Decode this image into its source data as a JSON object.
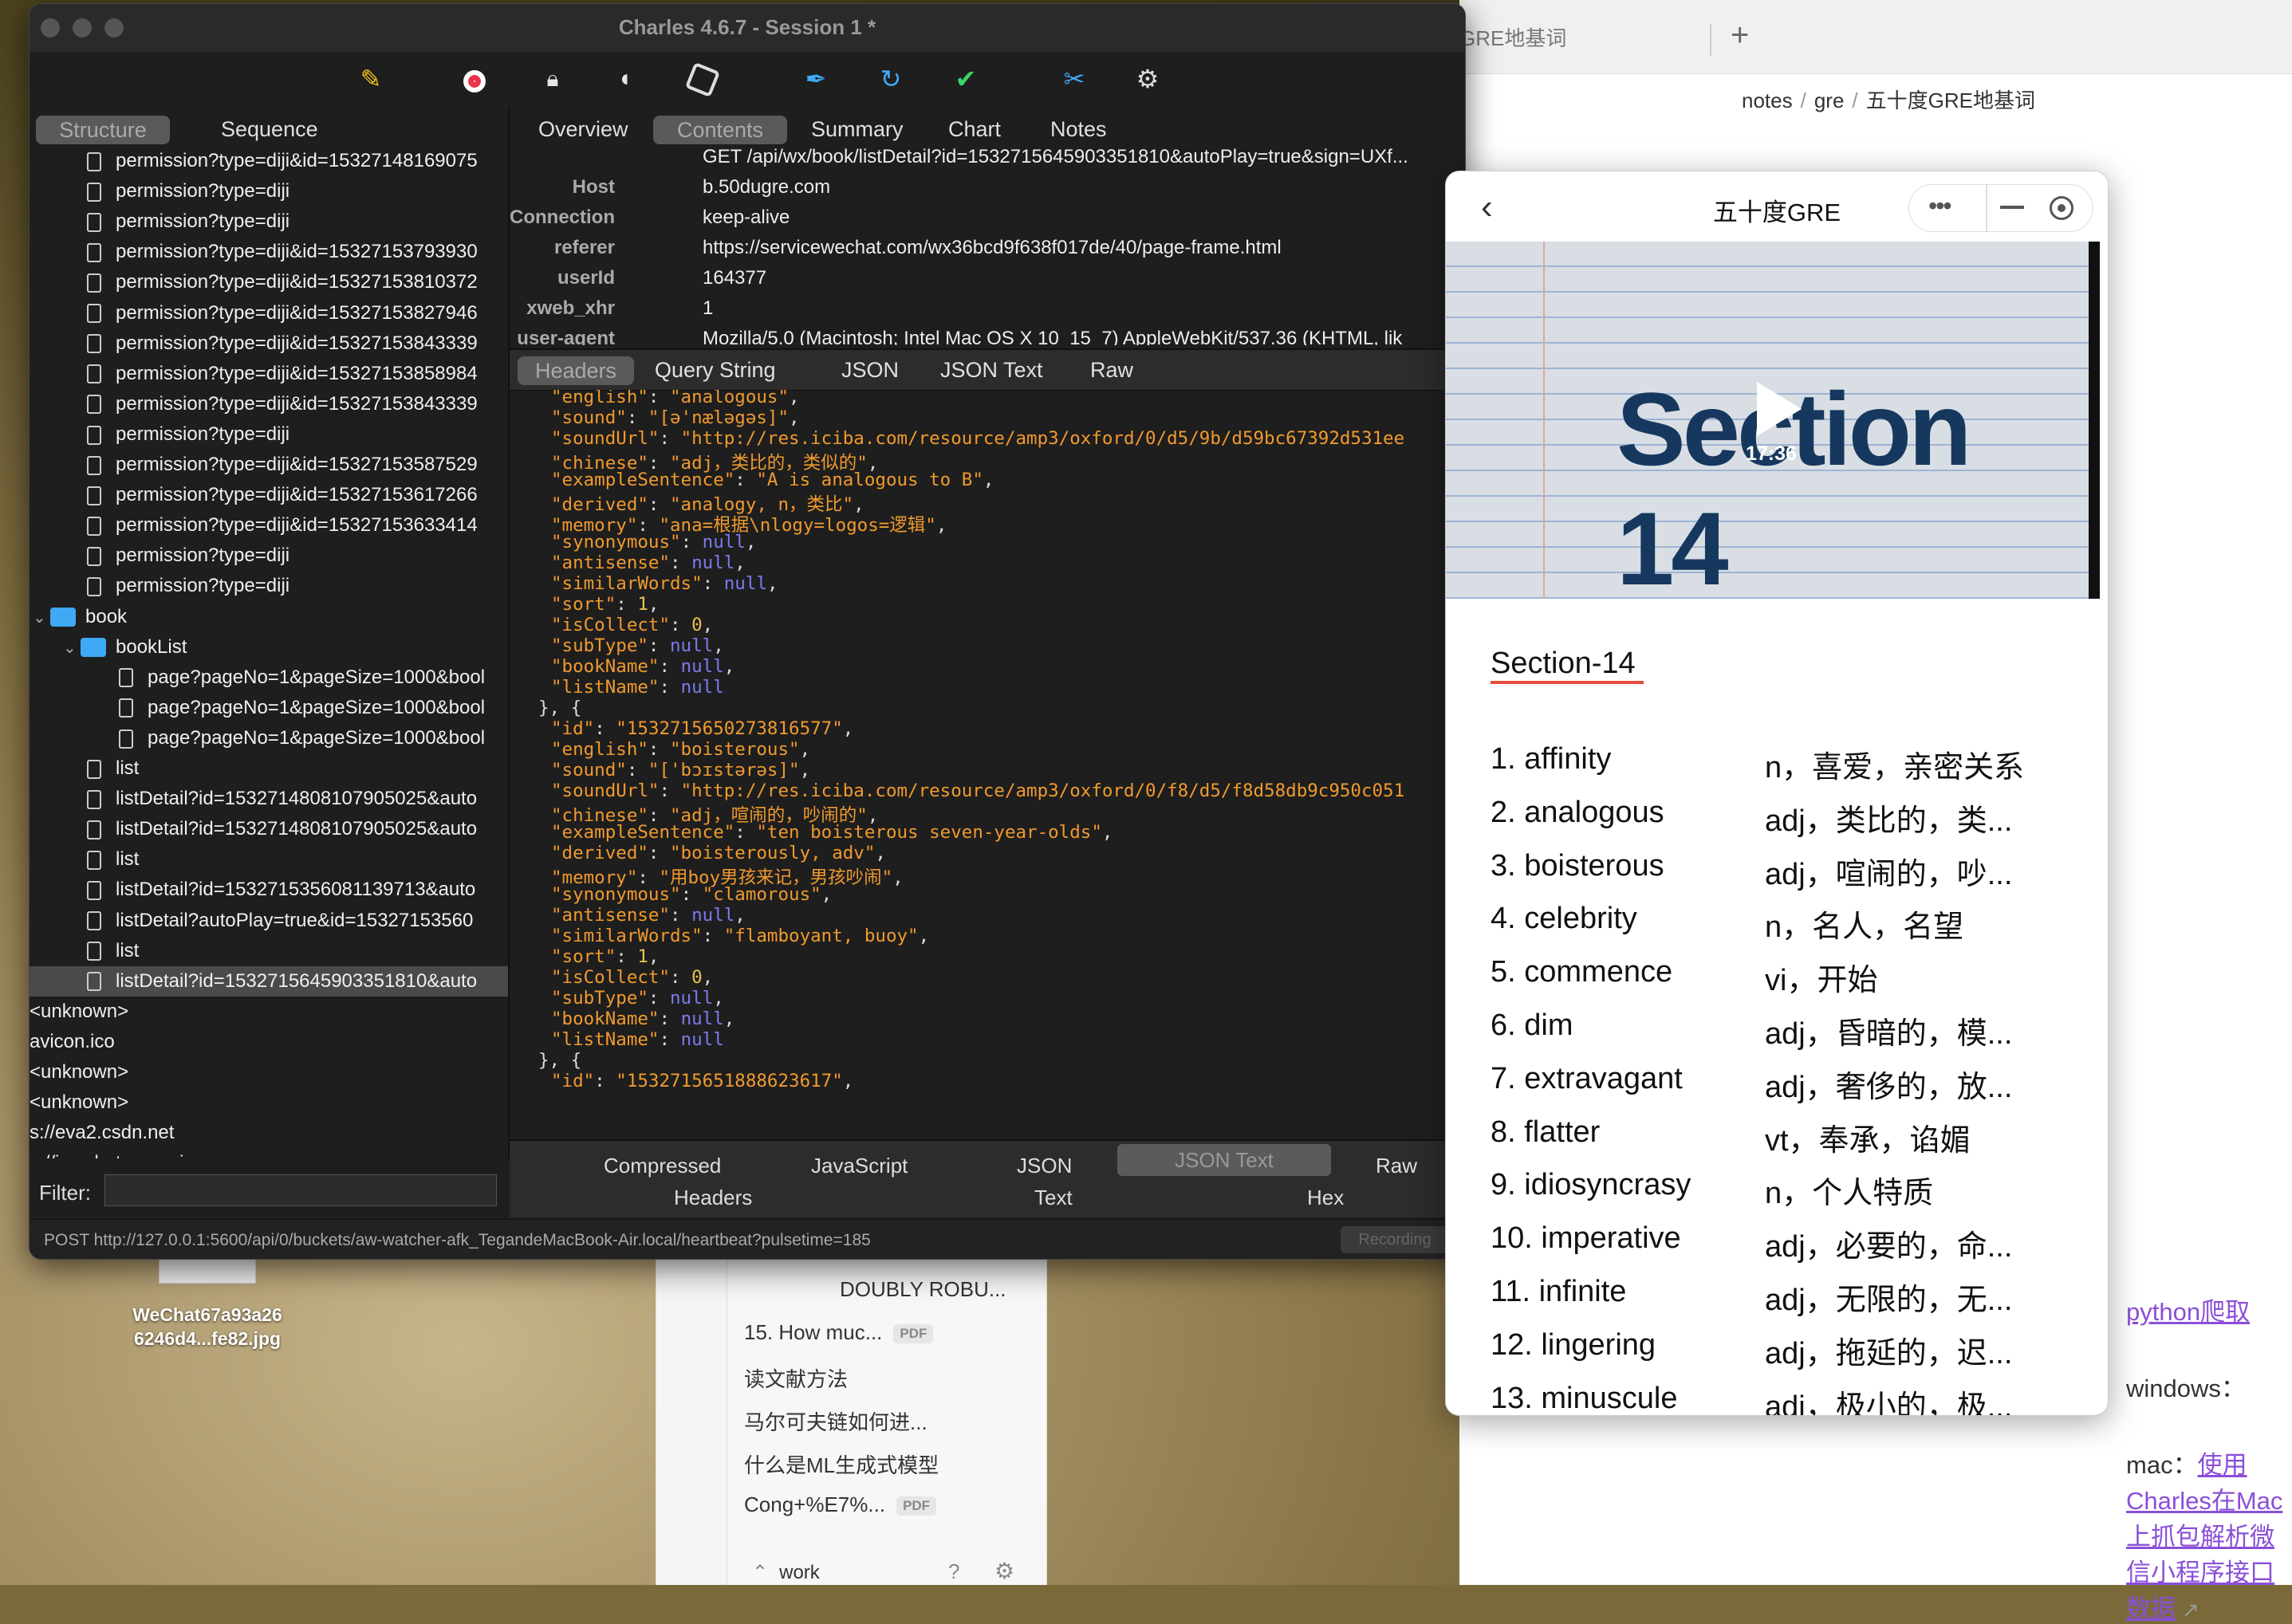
{
  "desktop": {
    "file_name_line1": "WeChat67a93a26",
    "file_name_line2": "6246d4...fe82.jpg"
  },
  "browser": {
    "tab_label": "GRE地基词",
    "new_tab_symbol": "+",
    "breadcrumb": [
      "notes",
      "gre",
      "五十度GRE地基词"
    ],
    "python_link": "python爬取",
    "windows_label": "windows：",
    "mac_label": "mac：",
    "mac_link": "使用Charles在Mac上抓包解析微信小程序接口数据"
  },
  "notes_sidebar": {
    "items": [
      {
        "label": "DOUBLY ROBU...",
        "badge": ""
      },
      {
        "label": "15. How muc...",
        "badge": "PDF"
      },
      {
        "label": "读文献方法",
        "badge": ""
      },
      {
        "label": "马尔可夫链如何进...",
        "badge": ""
      },
      {
        "label": "什么是ML生成式模型",
        "badge": ""
      },
      {
        "label": "Cong+%E7%...",
        "badge": "PDF"
      }
    ],
    "workspace": "work"
  },
  "charles": {
    "title": "Charles 4.6.7 - Session 1 *",
    "toolbar_icons": [
      "broom-icon",
      "record-icon",
      "lock-icon",
      "turtle-icon",
      "stop-icon",
      "pen-icon",
      "refresh-icon",
      "check-icon",
      "tools-icon",
      "settings-icon"
    ],
    "left_tabs": {
      "structure": "Structure",
      "sequence": "Sequence"
    },
    "right_tabs": {
      "overview": "Overview",
      "contents": "Contents",
      "summary": "Summary",
      "chart": "Chart",
      "notes": "Notes"
    },
    "tree": [
      {
        "indent": 2,
        "type": "file",
        "label": "permission?type=diji&id=15327148169075"
      },
      {
        "indent": 2,
        "type": "file",
        "label": "permission?type=diji"
      },
      {
        "indent": 2,
        "type": "file",
        "label": "permission?type=diji"
      },
      {
        "indent": 2,
        "type": "file",
        "label": "permission?type=diji&id=15327153793930"
      },
      {
        "indent": 2,
        "type": "file",
        "label": "permission?type=diji&id=15327153810372"
      },
      {
        "indent": 2,
        "type": "file",
        "label": "permission?type=diji&id=15327153827946"
      },
      {
        "indent": 2,
        "type": "file",
        "label": "permission?type=diji&id=15327153843339"
      },
      {
        "indent": 2,
        "type": "file",
        "label": "permission?type=diji&id=15327153858984"
      },
      {
        "indent": 2,
        "type": "file",
        "label": "permission?type=diji&id=15327153843339"
      },
      {
        "indent": 2,
        "type": "file",
        "label": "permission?type=diji"
      },
      {
        "indent": 2,
        "type": "file",
        "label": "permission?type=diji&id=15327153587529"
      },
      {
        "indent": 2,
        "type": "file",
        "label": "permission?type=diji&id=15327153617266"
      },
      {
        "indent": 2,
        "type": "file",
        "label": "permission?type=diji&id=15327153633414"
      },
      {
        "indent": 2,
        "type": "file",
        "label": "permission?type=diji"
      },
      {
        "indent": 2,
        "type": "file",
        "label": "permission?type=diji"
      },
      {
        "indent": 1,
        "type": "folder",
        "label": "book",
        "expanded": true
      },
      {
        "indent": 2,
        "type": "folder",
        "label": "bookList",
        "expanded": true
      },
      {
        "indent": 3,
        "type": "file",
        "label": "page?pageNo=1&pageSize=1000&bool"
      },
      {
        "indent": 3,
        "type": "file",
        "label": "page?pageNo=1&pageSize=1000&bool"
      },
      {
        "indent": 3,
        "type": "file",
        "label": "page?pageNo=1&pageSize=1000&bool"
      },
      {
        "indent": 2,
        "type": "file",
        "label": "list"
      },
      {
        "indent": 2,
        "type": "file",
        "label": "listDetail?id=1532714808107905025&auto"
      },
      {
        "indent": 2,
        "type": "file",
        "label": "listDetail?id=1532714808107905025&auto"
      },
      {
        "indent": 2,
        "type": "file",
        "label": "list"
      },
      {
        "indent": 2,
        "type": "file",
        "label": "listDetail?id=1532715356081139713&auto"
      },
      {
        "indent": 2,
        "type": "file",
        "label": "listDetail?autoPlay=true&id=15327153560"
      },
      {
        "indent": 2,
        "type": "file",
        "label": "list"
      },
      {
        "indent": 2,
        "type": "file",
        "label": "listDetail?id=1532715645903351810&auto",
        "selected": true
      },
      {
        "indent": 0,
        "type": "text",
        "label": "<unknown>"
      },
      {
        "indent": 0,
        "type": "text",
        "label": "avicon.ico"
      },
      {
        "indent": 0,
        "type": "text",
        "label": "<unknown>"
      },
      {
        "indent": 0,
        "type": "text",
        "label": "<unknown>"
      },
      {
        "indent": 0,
        "type": "text",
        "label": "s://eva2.csdn.net"
      },
      {
        "indent": 0,
        "type": "text",
        "label": "s://ios.chat.openai.com"
      }
    ],
    "request_headers": [
      {
        "key": "",
        "value": "GET /api/wx/book/listDetail?id=1532715645903351810&autoPlay=true&sign=UXf..."
      },
      {
        "key": "Host",
        "value": "b.50dugre.com"
      },
      {
        "key": "Connection",
        "value": "keep-alive"
      },
      {
        "key": "referer",
        "value": "https://servicewechat.com/wx36bcd9f638f017de/40/page-frame.html"
      },
      {
        "key": "userId",
        "value": "164377"
      },
      {
        "key": "xweb_xhr",
        "value": "1"
      },
      {
        "key": "user-agent",
        "value": "Mozilla/5.0 (Macintosh; Intel Mac OS X 10_15_7) AppleWebKit/537.36 (KHTML, lik"
      }
    ],
    "request_tabs": [
      "Headers",
      "Query String",
      "JSON",
      "JSON Text",
      "Raw"
    ],
    "json_lines": [
      [
        6,
        "k",
        "\"english\"",
        "s",
        "\"analogous\"",
        "p",
        ","
      ],
      [
        6,
        "k",
        "\"sound\"",
        "s",
        "\"[ə'næləgəs]\"",
        "p",
        ","
      ],
      [
        6,
        "k",
        "\"soundUrl\"",
        "s",
        "\"http://res.iciba.com/resource/amp3/oxford/0/d5/9b/d59bc67392d531ee"
      ],
      [
        6,
        "k",
        "\"chinese\"",
        "s",
        "\"adj，类比的，类似的\"",
        "p",
        ","
      ],
      [
        6,
        "k",
        "\"exampleSentence\"",
        "s",
        "\"A is analogous to B\"",
        "p",
        ","
      ],
      [
        6,
        "k",
        "\"derived\"",
        "s",
        "\"analogy, n，类比\"",
        "p",
        ","
      ],
      [
        6,
        "k",
        "\"memory\"",
        "s",
        "\"ana=根据\\nlogy=logos=逻辑\"",
        "p",
        ","
      ],
      [
        6,
        "k",
        "\"synonymous\"",
        "n",
        "null",
        "p",
        ","
      ],
      [
        6,
        "k",
        "\"antisense\"",
        "n",
        "null",
        "p",
        ","
      ],
      [
        6,
        "k",
        "\"similarWords\"",
        "n",
        "null",
        "p",
        ","
      ],
      [
        6,
        "k",
        "\"sort\"",
        "num",
        "1",
        "p",
        ","
      ],
      [
        6,
        "k",
        "\"isCollect\"",
        "num",
        "0",
        "p",
        ","
      ],
      [
        6,
        "k",
        "\"subType\"",
        "n",
        "null",
        "p",
        ","
      ],
      [
        6,
        "k",
        "\"bookName\"",
        "n",
        "null",
        "p",
        ","
      ],
      [
        6,
        "k",
        "\"listName\"",
        "n",
        "null"
      ],
      [
        4,
        "p",
        "}, {"
      ],
      [
        6,
        "k",
        "\"id\"",
        "s",
        "\"1532715650273816577\"",
        "p",
        ","
      ],
      [
        6,
        "k",
        "\"english\"",
        "s",
        "\"boisterous\"",
        "p",
        ","
      ],
      [
        6,
        "k",
        "\"sound\"",
        "s",
        "\"['bɔɪstərəs]\"",
        "p",
        ","
      ],
      [
        6,
        "k",
        "\"soundUrl\"",
        "s",
        "\"http://res.iciba.com/resource/amp3/oxford/0/f8/d5/f8d58db9c950c051"
      ],
      [
        6,
        "k",
        "\"chinese\"",
        "s",
        "\"adj，喧闹的，吵闹的\"",
        "p",
        ","
      ],
      [
        6,
        "k",
        "\"exampleSentence\"",
        "s",
        "\"ten boisterous seven-year-olds\"",
        "p",
        ","
      ],
      [
        6,
        "k",
        "\"derived\"",
        "s",
        "\"boisterously, adv\"",
        "p",
        ","
      ],
      [
        6,
        "k",
        "\"memory\"",
        "s",
        "\"用boy男孩来记，男孩吵闹\"",
        "p",
        ","
      ],
      [
        6,
        "k",
        "\"synonymous\"",
        "s",
        "\"clamorous\"",
        "p",
        ","
      ],
      [
        6,
        "k",
        "\"antisense\"",
        "n",
        "null",
        "p",
        ","
      ],
      [
        6,
        "k",
        "\"similarWords\"",
        "s",
        "\"flamboyant, buoy\"",
        "p",
        ","
      ],
      [
        6,
        "k",
        "\"sort\"",
        "num",
        "1",
        "p",
        ","
      ],
      [
        6,
        "k",
        "\"isCollect\"",
        "num",
        "0",
        "p",
        ","
      ],
      [
        6,
        "k",
        "\"subType\"",
        "n",
        "null",
        "p",
        ","
      ],
      [
        6,
        "k",
        "\"bookName\"",
        "n",
        "null",
        "p",
        ","
      ],
      [
        6,
        "k",
        "\"listName\"",
        "n",
        "null"
      ],
      [
        4,
        "p",
        "}, {"
      ],
      [
        6,
        "k",
        "\"id\"",
        "s",
        "\"1532715651888623617\"",
        "p",
        ","
      ]
    ],
    "response_tabs_row1": [
      "Compressed",
      "JavaScript",
      "JSON",
      "JSON Text",
      "Raw"
    ],
    "response_tabs_row2": [
      "Headers",
      "Text",
      "Hex"
    ],
    "filter_label": "Filter:",
    "status_text": "POST http://127.0.0.1:5600/api/0/buckets/aw-watcher-afk_TegandeMacBook-Air.local/heartbeat?pulsetime=185",
    "recording_label": "Recording"
  },
  "mini_program": {
    "title": "五十度GRE",
    "video_text": "Section 14",
    "video_time": "17:36",
    "section_title": "Section-14",
    "words": [
      {
        "word": "1. affinity",
        "meaning": "n，喜爱，亲密关系"
      },
      {
        "word": "2. analogous",
        "meaning": "adj，类比的，类..."
      },
      {
        "word": "3. boisterous",
        "meaning": "adj，喧闹的，吵..."
      },
      {
        "word": "4. celebrity",
        "meaning": "n，名人，名望"
      },
      {
        "word": "5. commence",
        "meaning": "vi，开始"
      },
      {
        "word": "6. dim",
        "meaning": "adj，昏暗的，模..."
      },
      {
        "word": "7. extravagant",
        "meaning": "adj，奢侈的，放..."
      },
      {
        "word": "8. flatter",
        "meaning": "vt，奉承，谄媚"
      },
      {
        "word": "9. idiosyncrasy",
        "meaning": "n，个人特质"
      },
      {
        "word": "10. imperative",
        "meaning": "adj，必要的，命..."
      },
      {
        "word": "11. infinite",
        "meaning": "adj，无限的，无..."
      },
      {
        "word": "12. lingering",
        "meaning": "adj，拖延的，迟..."
      },
      {
        "word": "13. minuscule",
        "meaning": "adj，极小的，极..."
      }
    ]
  }
}
